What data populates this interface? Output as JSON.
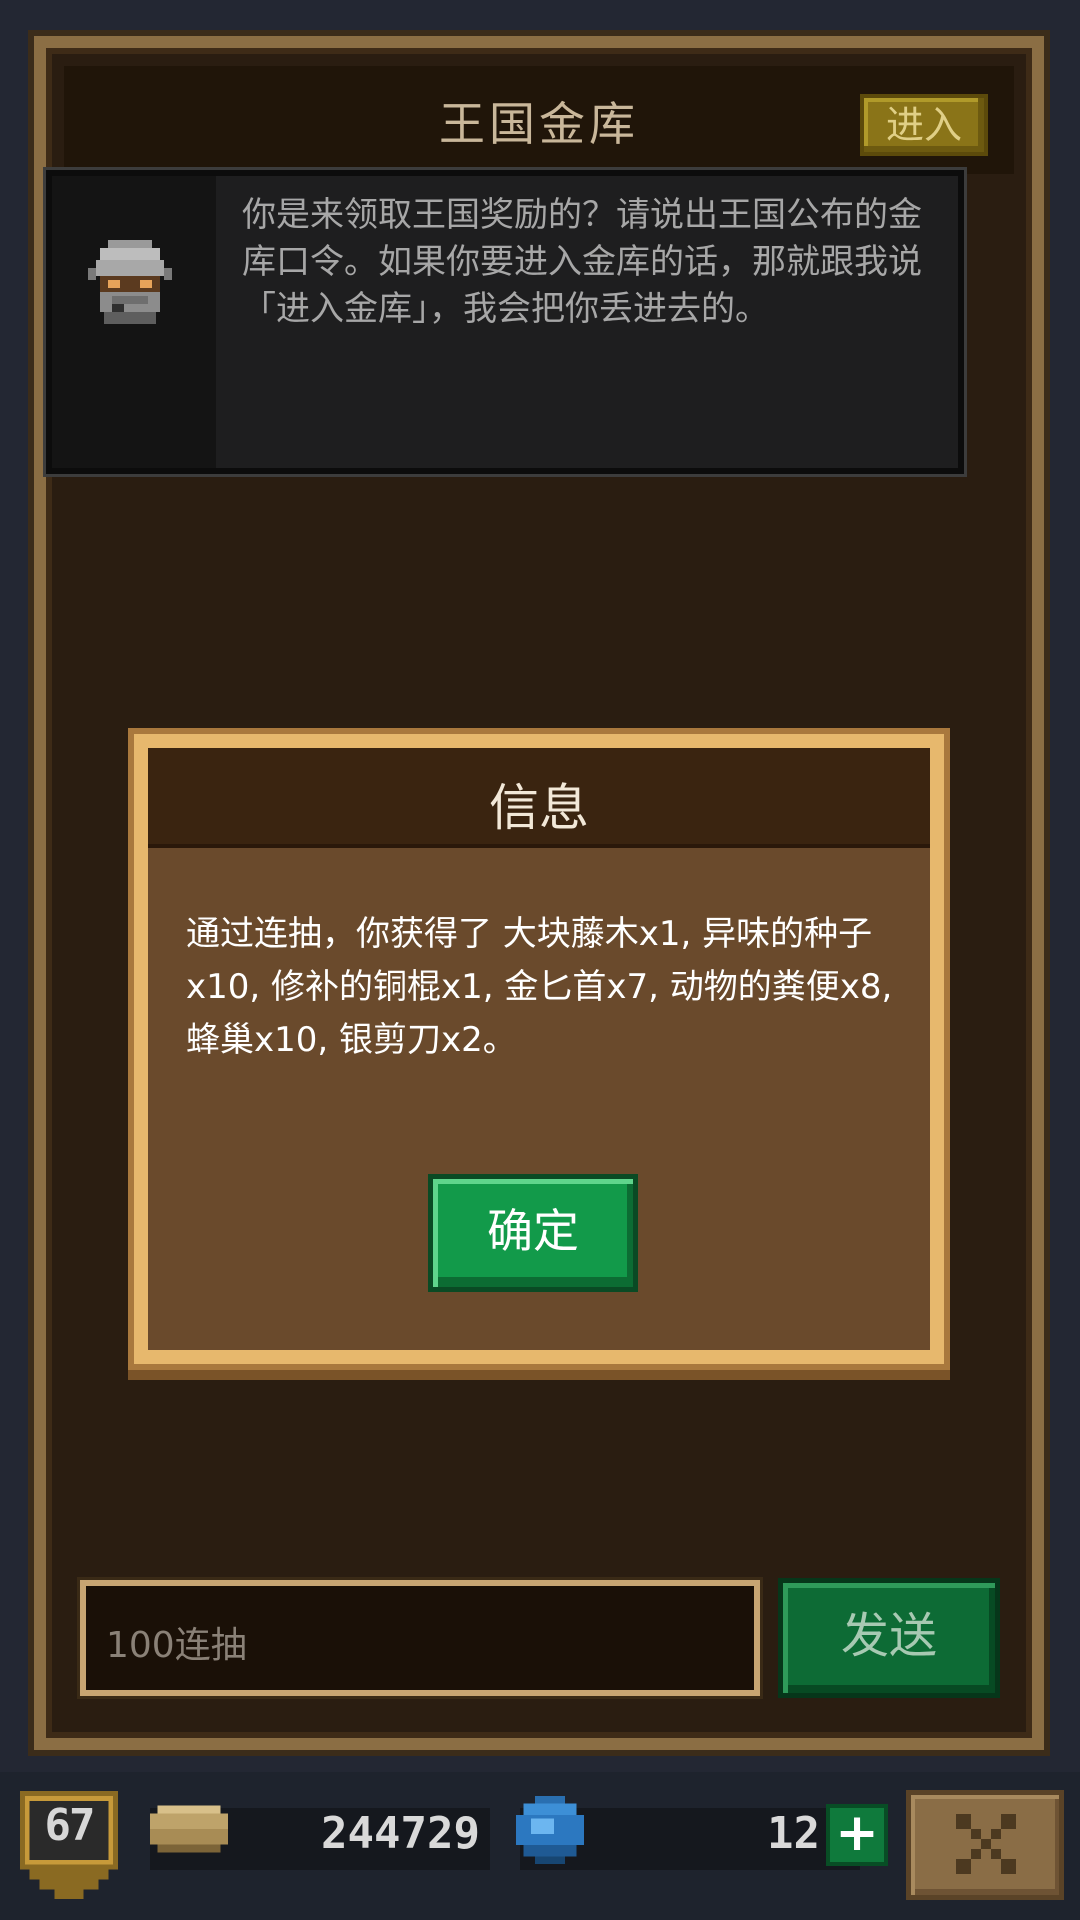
{
  "panel": {
    "title": "王国金库",
    "enter_label": "进入"
  },
  "npc": {
    "avatar_icon": "knight-helmet-icon",
    "message": "你是来领取王国奖励的？请说出王国公布的金库口令。如果你要进入金库的话，那就跟我说「进入金库」，我会把你丢进去的。"
  },
  "modal": {
    "title": "信息",
    "body": "通过连抽，你获得了 大块藤木x1, 异味的种子x10, 修补的铜棍x1, 金匕首x7, 动物的粪便x8, 蜂巢x10, 银剪刀x2。",
    "confirm_label": "确定"
  },
  "input": {
    "value": "100连抽",
    "send_label": "发送"
  },
  "status_bar": {
    "level": "67",
    "coins": "244729",
    "gems": "12",
    "add_label": "+",
    "coin_icon": "coin-stack-icon",
    "gem_icon": "blue-gem-icon",
    "close_icon": "close-icon"
  },
  "colors": {
    "accent_gold": "#e7b86d",
    "confirm_green": "#129a4a",
    "send_green": "#0d6b35",
    "enter_yellow": "#8a7418"
  }
}
